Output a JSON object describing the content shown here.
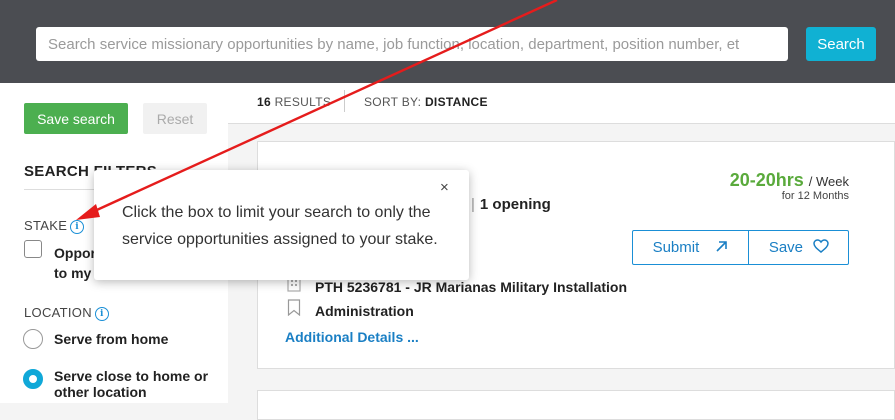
{
  "header": {
    "search_placeholder": "Search service missionary opportunities by name, job function, location, department, position number, et",
    "search_button": "Search"
  },
  "sidebar": {
    "save_search": "Save search",
    "reset": "Reset",
    "filters_heading": "SEARCH FILTERS",
    "stake_label": "STAKE",
    "stake_checkbox_label_1": "Oppor",
    "stake_checkbox_label_2": "to my",
    "location_label": "LOCATION",
    "location_options": [
      {
        "label_1": "Serve from home",
        "label_2": "",
        "selected": false
      },
      {
        "label_1": "Serve close to home or",
        "label_2": "other location",
        "selected": true
      }
    ]
  },
  "results": {
    "count": "16",
    "count_suffix": "RESULTS",
    "sort_prefix": "SORT BY:",
    "sort_value": "DISTANCE"
  },
  "card": {
    "hours": "20-20hrs",
    "hours_unit": "/ Week",
    "duration": "for 12 Months",
    "opening_pipe": "|",
    "openings": "1 opening",
    "opening_fragment": ")",
    "submit": "Submit",
    "save": "Save",
    "position": "PTH 5236781 - JR Marianas Military Installation",
    "department": "Administration",
    "additional_details": "Additional Details ..."
  },
  "tooltip": {
    "close": "×",
    "text": "Click the box to limit your search to only the service opportunities assigned to your stake."
  },
  "colors": {
    "accent": "#10b1d3",
    "link": "#1a7fc4",
    "hours_green": "#5aaa3c",
    "save_search_green": "#4caf50",
    "annotation_red": "#e51c1c"
  }
}
